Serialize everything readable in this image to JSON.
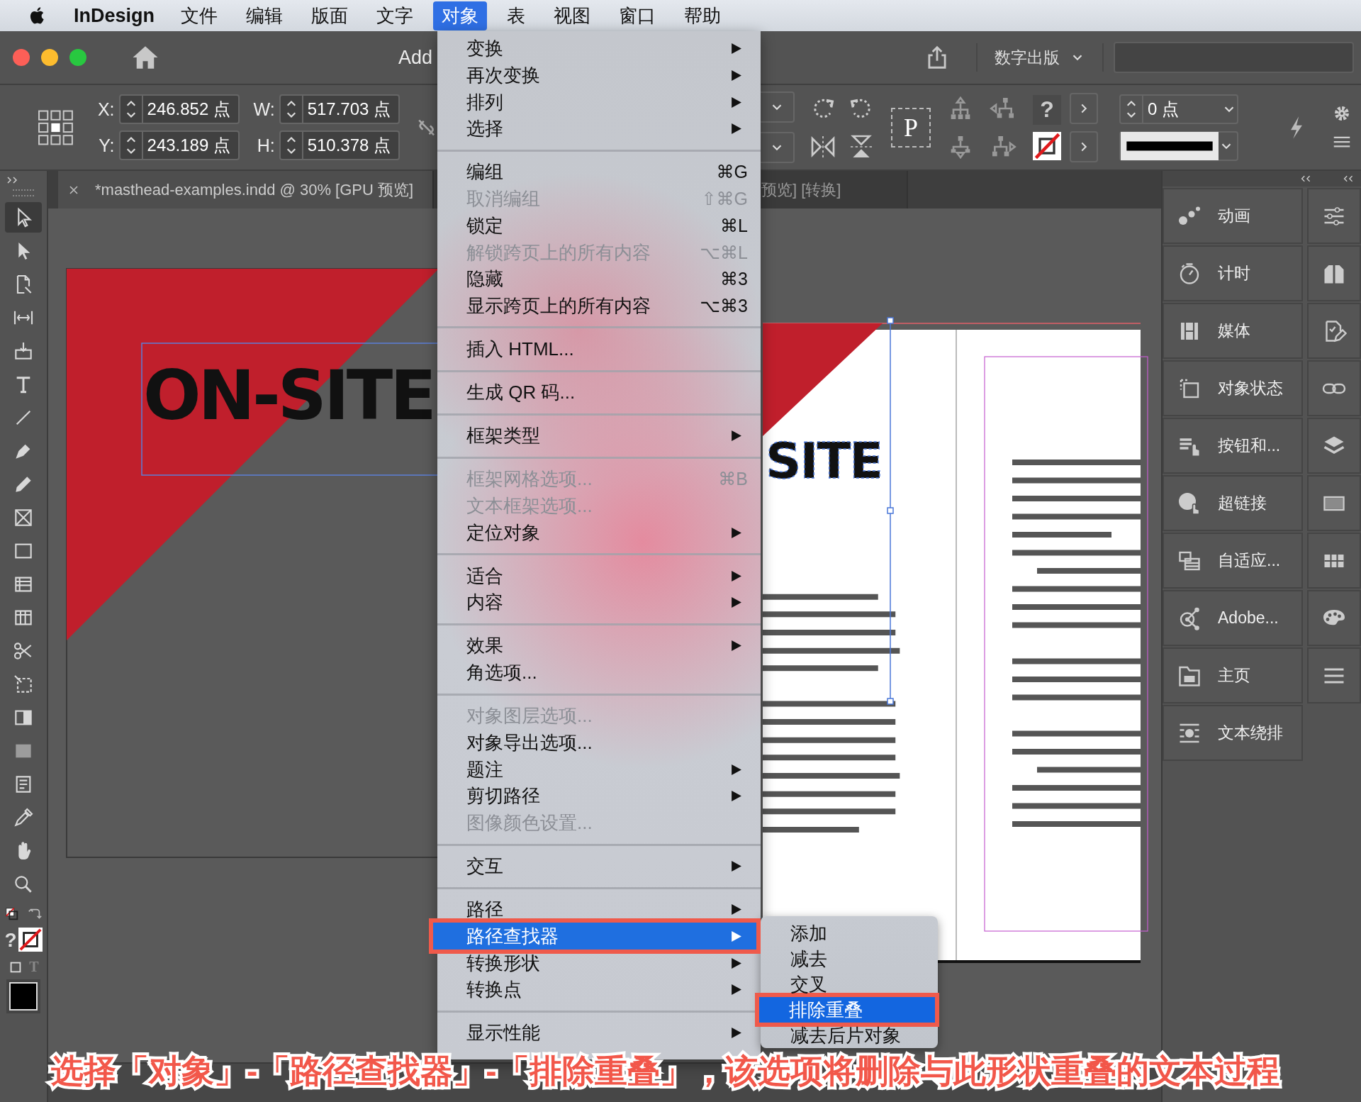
{
  "menubar": {
    "app": "InDesign",
    "items": [
      {
        "label": "文件",
        "selected": false
      },
      {
        "label": "编辑",
        "selected": false
      },
      {
        "label": "版面",
        "selected": false
      },
      {
        "label": "文字",
        "selected": false
      },
      {
        "label": "对象",
        "selected": true
      },
      {
        "label": "表",
        "selected": false
      },
      {
        "label": "视图",
        "selected": false
      },
      {
        "label": "窗口",
        "selected": false
      },
      {
        "label": "帮助",
        "selected": false
      }
    ]
  },
  "window": {
    "title": "Add",
    "workspace": "数字出版"
  },
  "control_bar": {
    "fields": [
      {
        "label": "X:",
        "value": "246.852 点"
      },
      {
        "label": "W:",
        "value": "517.703 点"
      },
      {
        "label": "Y:",
        "value": "243.189 点"
      },
      {
        "label": "H:",
        "value": "510.378 点"
      }
    ],
    "content_label": "P",
    "fill_label": "?",
    "stroke_weight": "0 点"
  },
  "document_tabs": [
    {
      "title": "*masthead-examples.indd @ 30% [GPU 预览]",
      "selected": true
    },
    {
      "title": "预览] [转换]",
      "selected": false
    }
  ],
  "tools": [
    {
      "selected": true
    },
    {
      "selected": false
    },
    {
      "selected": false
    },
    {
      "selected": false
    },
    {
      "selected": false
    },
    {
      "selected": false
    },
    {
      "selected": false
    },
    {
      "selected": false
    },
    {
      "selected": false
    },
    {
      "selected": false
    },
    {
      "selected": false
    },
    {
      "selected": false
    },
    {
      "selected": false
    },
    {
      "selected": false
    },
    {
      "selected": false
    },
    {
      "selected": false
    },
    {
      "selected": false
    },
    {
      "selected": false
    },
    {
      "selected": false
    },
    {
      "selected": false
    },
    {
      "selected": false
    }
  ],
  "toolbar_swatch": {
    "fill_label": "?",
    "format_label": "T"
  },
  "canvas": {
    "headline_left": "ON-SITE",
    "headline_right": "SITE"
  },
  "panels": [
    {
      "label": "动画"
    },
    {
      "label": "计时"
    },
    {
      "label": "媒体"
    },
    {
      "label": "对象状态"
    },
    {
      "label": "按钮和..."
    },
    {
      "label": "超链接"
    },
    {
      "label": "自适应..."
    },
    {
      "label": "Adobe..."
    },
    {
      "label": "主页"
    },
    {
      "label": "文本绕排"
    }
  ],
  "menu": {
    "items": [
      {
        "kind": "item",
        "label": "变换",
        "has_submenu": true,
        "disabled": false,
        "selected": false
      },
      {
        "kind": "item",
        "label": "再次变换",
        "has_submenu": true,
        "disabled": false,
        "selected": false
      },
      {
        "kind": "item",
        "label": "排列",
        "has_submenu": true,
        "disabled": false,
        "selected": false
      },
      {
        "kind": "item",
        "label": "选择",
        "has_submenu": true,
        "disabled": false,
        "selected": false
      },
      {
        "kind": "separator"
      },
      {
        "kind": "item",
        "label": "编组",
        "shortcut": "⌘G",
        "disabled": false,
        "selected": false
      },
      {
        "kind": "item",
        "label": "取消编组",
        "shortcut": "⇧⌘G",
        "disabled": true,
        "selected": false
      },
      {
        "kind": "item",
        "label": "锁定",
        "shortcut": "⌘L",
        "disabled": false,
        "selected": false
      },
      {
        "kind": "item",
        "label": "解锁跨页上的所有内容",
        "shortcut": "⌥⌘L",
        "disabled": true,
        "selected": false
      },
      {
        "kind": "item",
        "label": "隐藏",
        "shortcut": "⌘3",
        "disabled": false,
        "selected": false
      },
      {
        "kind": "item",
        "label": "显示跨页上的所有内容",
        "shortcut": "⌥⌘3",
        "disabled": false,
        "selected": false
      },
      {
        "kind": "separator"
      },
      {
        "kind": "item",
        "label": "插入 HTML...",
        "disabled": false,
        "selected": false
      },
      {
        "kind": "separator"
      },
      {
        "kind": "item",
        "label": "生成 QR 码...",
        "disabled": false,
        "selected": false
      },
      {
        "kind": "separator"
      },
      {
        "kind": "item",
        "label": "框架类型",
        "has_submenu": true,
        "disabled": false,
        "selected": false
      },
      {
        "kind": "separator"
      },
      {
        "kind": "item",
        "label": "框架网格选项...",
        "shortcut": "⌘B",
        "disabled": true,
        "selected": false
      },
      {
        "kind": "item",
        "label": "文本框架选项...",
        "disabled": true,
        "selected": false
      },
      {
        "kind": "item",
        "label": "定位对象",
        "has_submenu": true,
        "disabled": false,
        "selected": false
      },
      {
        "kind": "separator"
      },
      {
        "kind": "item",
        "label": "适合",
        "has_submenu": true,
        "disabled": false,
        "selected": false
      },
      {
        "kind": "item",
        "label": "内容",
        "has_submenu": true,
        "disabled": false,
        "selected": false
      },
      {
        "kind": "separator"
      },
      {
        "kind": "item",
        "label": "效果",
        "has_submenu": true,
        "disabled": false,
        "selected": false
      },
      {
        "kind": "item",
        "label": "角选项...",
        "disabled": false,
        "selected": false
      },
      {
        "kind": "separator"
      },
      {
        "kind": "item",
        "label": "对象图层选项...",
        "disabled": true,
        "selected": false
      },
      {
        "kind": "item",
        "label": "对象导出选项...",
        "disabled": false,
        "selected": false
      },
      {
        "kind": "item",
        "label": "题注",
        "has_submenu": true,
        "disabled": false,
        "selected": false
      },
      {
        "kind": "item",
        "label": "剪切路径",
        "has_submenu": true,
        "disabled": false,
        "selected": false
      },
      {
        "kind": "item",
        "label": "图像颜色设置...",
        "disabled": true,
        "selected": false
      },
      {
        "kind": "separator"
      },
      {
        "kind": "item",
        "label": "交互",
        "has_submenu": true,
        "disabled": false,
        "selected": false
      },
      {
        "kind": "separator"
      },
      {
        "kind": "item",
        "label": "路径",
        "has_submenu": true,
        "disabled": false,
        "selected": false
      },
      {
        "kind": "item",
        "label": "路径查找器",
        "has_submenu": true,
        "disabled": false,
        "selected": true,
        "callout": true
      },
      {
        "kind": "item",
        "label": "转换形状",
        "has_submenu": true,
        "disabled": false,
        "selected": false
      },
      {
        "kind": "item",
        "label": "转换点",
        "has_submenu": true,
        "disabled": false,
        "selected": false
      },
      {
        "kind": "separator"
      },
      {
        "kind": "item",
        "label": "显示性能",
        "has_submenu": true,
        "disabled": false,
        "selected": false
      }
    ]
  },
  "submenu": {
    "items": [
      {
        "label": "添加",
        "selected": false
      },
      {
        "label": "减去",
        "selected": false
      },
      {
        "label": "交叉",
        "selected": false
      },
      {
        "label": "排除重叠",
        "selected": true,
        "callout": true
      },
      {
        "label": "减去后片对象",
        "selected": false
      }
    ]
  },
  "caption": "选择「对象」-「路径查找器」-「排除重叠」，该选项将删除与此形状重叠的文本过程"
}
